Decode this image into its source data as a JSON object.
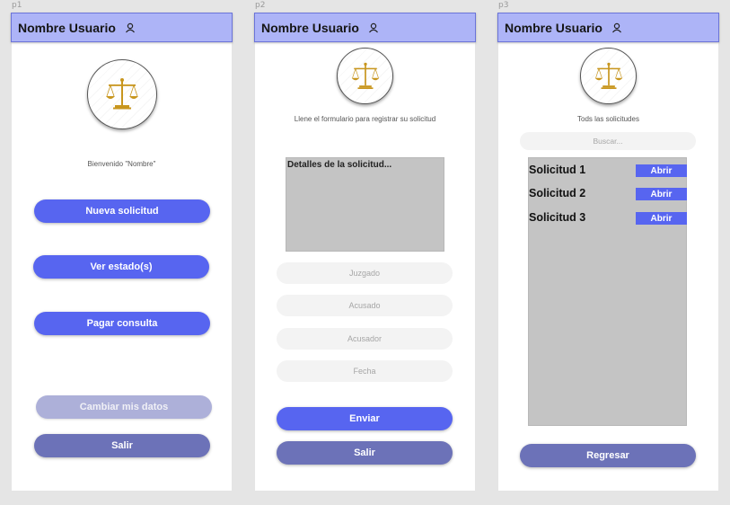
{
  "frames": [
    {
      "label": "p1",
      "header": {
        "user_name": "Nombre Usuario"
      },
      "welcome": "Bienvenido \"Nombre\"",
      "buttons": {
        "new_request": "Nueva solicitud",
        "view_status": "Ver estado(s)",
        "pay_consult": "Pagar consulta",
        "change_data": "Cambiar mis datos",
        "exit": "Salir"
      }
    },
    {
      "label": "p2",
      "header": {
        "user_name": "Nombre Usuario"
      },
      "instructions": "Llene el formulario para registrar su solicitud",
      "details_placeholder": "Detalles de la solicitud...",
      "fields": {
        "court": "Juzgado",
        "accused": "Acusado",
        "accuser": "Acusador",
        "date": "Fecha"
      },
      "buttons": {
        "send": "Enviar",
        "exit": "Salir"
      }
    },
    {
      "label": "p3",
      "header": {
        "user_name": "Nombre Usuario"
      },
      "title": "Tods las solicitudes",
      "search_placeholder": "Buscar...",
      "requests": [
        {
          "name": "Solicitud  1",
          "action": "Abrir"
        },
        {
          "name": "Solicitud  2",
          "action": "Abrir"
        },
        {
          "name": "Solicitud  3",
          "action": "Abrir"
        }
      ],
      "buttons": {
        "back": "Regresar"
      }
    }
  ],
  "colors": {
    "header_bg": "#adb4f7",
    "primary_button": "#5765f0",
    "muted_button": "#adb0d9",
    "dark_button": "#6c72b8",
    "logo_gold": "#c8961e"
  },
  "icons": {
    "header": "user-icon",
    "logo": "scales-of-justice-icon"
  }
}
